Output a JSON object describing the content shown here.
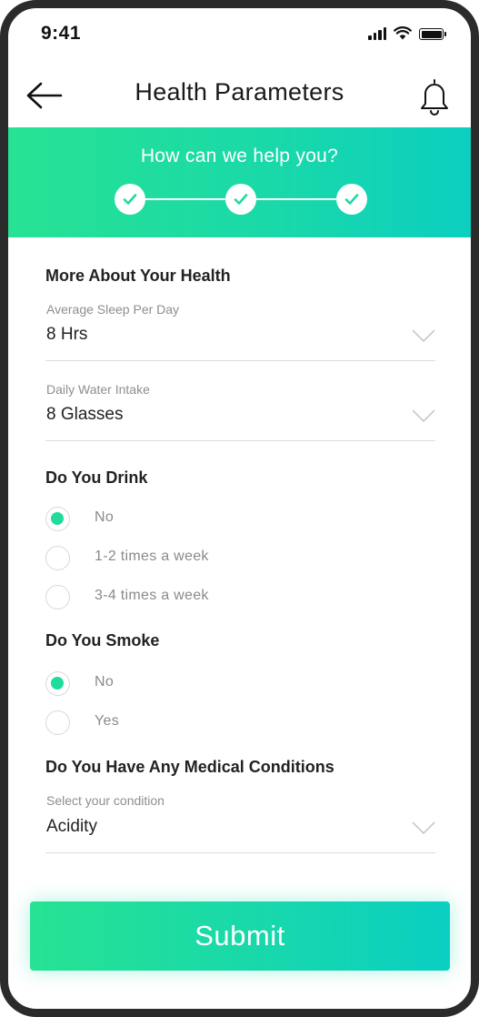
{
  "status_bar": {
    "time": "9:41"
  },
  "header": {
    "title": "Health Parameters"
  },
  "banner": {
    "title": "How can we help you?",
    "steps_completed": 3,
    "steps_total": 3
  },
  "health": {
    "section_title": "More About Your Health",
    "sleep": {
      "label": "Average Sleep Per Day",
      "value": "8 Hrs"
    },
    "water": {
      "label": "Daily Water Intake",
      "value": "8 Glasses"
    }
  },
  "drink": {
    "section_title": "Do You Drink",
    "options": [
      "No",
      "1-2 times a week",
      "3-4 times a week"
    ],
    "selected": "No"
  },
  "smoke": {
    "section_title": "Do You Smoke",
    "options": [
      "No",
      "Yes"
    ],
    "selected": "No"
  },
  "medical": {
    "section_title": "Do You Have Any Medical Conditions",
    "label": "Select your condition",
    "value": "Acidity"
  },
  "submit": {
    "label": "Submit"
  },
  "colors": {
    "accent": "#1fdb9e",
    "gradient_start": "#27e293",
    "gradient_end": "#0ccfc0"
  }
}
